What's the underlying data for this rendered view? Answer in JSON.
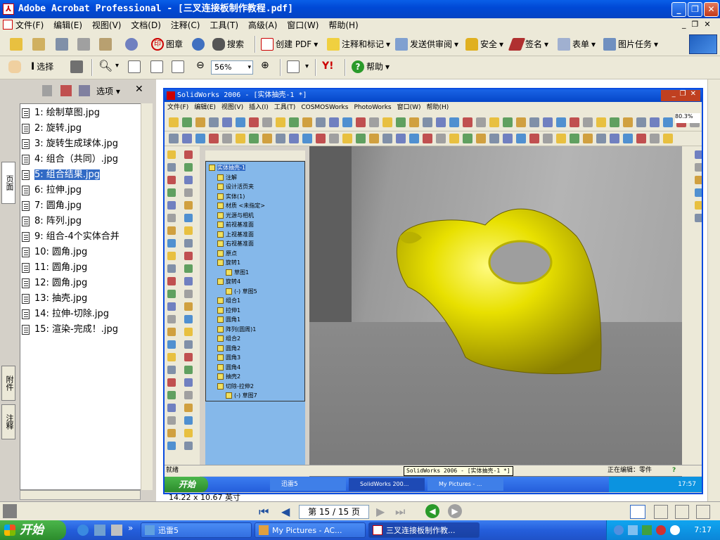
{
  "window": {
    "title": "Adobe Acrobat Professional - [三叉连接板制作教程.pdf]",
    "icon": "pdf-icon"
  },
  "menubar": [
    {
      "label": "文件(F)"
    },
    {
      "label": "编辑(E)"
    },
    {
      "label": "视图(V)"
    },
    {
      "label": "文档(D)"
    },
    {
      "label": "注释(C)"
    },
    {
      "label": "工具(T)"
    },
    {
      "label": "高级(A)"
    },
    {
      "label": "窗口(W)"
    },
    {
      "label": "帮助(H)"
    }
  ],
  "toolbar1": {
    "seal": "图章",
    "search": "搜索",
    "create_pdf": "创建 PDF",
    "comment": "注释和标记",
    "send_review": "发送供审阅",
    "security": "安全",
    "sign": "签名",
    "forms": "表单",
    "picture_task": "图片任务"
  },
  "toolbar2": {
    "select": "选择",
    "zoom": "56%",
    "help": "帮助",
    "yahoo": "Y!"
  },
  "left_panel": {
    "options": "选项",
    "tabs": {
      "pages": "页面",
      "attachments": "附件",
      "comments": "注释"
    },
    "items": [
      {
        "label": "1:  绘制草图.jpg"
      },
      {
        "label": "2:  旋转.jpg"
      },
      {
        "label": "3:  旋转生成球体.jpg"
      },
      {
        "label": "4:  组合（共同）.jpg"
      },
      {
        "label": "5:  组合结果.jpg",
        "selected": true
      },
      {
        "label": "6:  拉伸.jpg"
      },
      {
        "label": "7:  圆角.jpg"
      },
      {
        "label": "8:  阵列.jpg"
      },
      {
        "label": "9:  组合-4个实体合并"
      },
      {
        "label": "10:  圆角.jpg"
      },
      {
        "label": "11:  圆角.jpg"
      },
      {
        "label": "12:  圆角.jpg"
      },
      {
        "label": "13:  抽壳.jpg"
      },
      {
        "label": "14:  拉伸-切除.jpg"
      },
      {
        "label": "15:  渲染-完成！.jpg"
      }
    ]
  },
  "solidworks": {
    "title": "SolidWorks 2006 - [实体抽壳-1 *]",
    "menu": [
      "文件(F)",
      "编辑(E)",
      "视图(V)",
      "插入(I)",
      "工具(T)",
      "COSMOSWorks",
      "PhotoWorks",
      "窗口(W)",
      "帮助(H)"
    ],
    "zoom_badge": "80.3%",
    "tree": [
      {
        "label": "实体抽壳-1",
        "selected": true
      },
      {
        "label": "注解"
      },
      {
        "label": "设计活页夹"
      },
      {
        "label": "实体(1)"
      },
      {
        "label": "材质 <未指定>"
      },
      {
        "label": "光源与相机"
      },
      {
        "label": "前视基准面"
      },
      {
        "label": "上视基准面"
      },
      {
        "label": "右视基准面"
      },
      {
        "label": "原点"
      },
      {
        "label": "旋转1"
      },
      {
        "label": "草图1"
      },
      {
        "label": "旋转4"
      },
      {
        "label": "(-) 草图5"
      },
      {
        "label": "组合1"
      },
      {
        "label": "拉伸1"
      },
      {
        "label": "圆角1"
      },
      {
        "label": "阵列(圆周)1"
      },
      {
        "label": "组合2"
      },
      {
        "label": "圆角2"
      },
      {
        "label": "圆角3"
      },
      {
        "label": "圆角4"
      },
      {
        "label": "抽壳2"
      },
      {
        "label": "切除-拉伸2"
      },
      {
        "label": "(-) 草图7"
      }
    ],
    "status_left": "就绪",
    "status_tooltip": "SolidWorks 2006 - [实体抽壳-1 *]",
    "status_editing": "正在编辑：零件",
    "inner_taskbar": {
      "start": "开始",
      "items": [
        "迅雷5",
        "SolidWorks 200...",
        "My Pictures - ..."
      ],
      "time": "17:57"
    }
  },
  "statusbar": {
    "page_size": "14.22 x 10.67 英寸",
    "page_indicator": "第 15 / 15 页"
  },
  "taskbar": {
    "start": "开始",
    "items": [
      {
        "label": "迅雷5"
      },
      {
        "label": "My Pictures - AC..."
      },
      {
        "label": "三叉连接板制作教...",
        "active": true
      }
    ],
    "time": "7:17"
  }
}
